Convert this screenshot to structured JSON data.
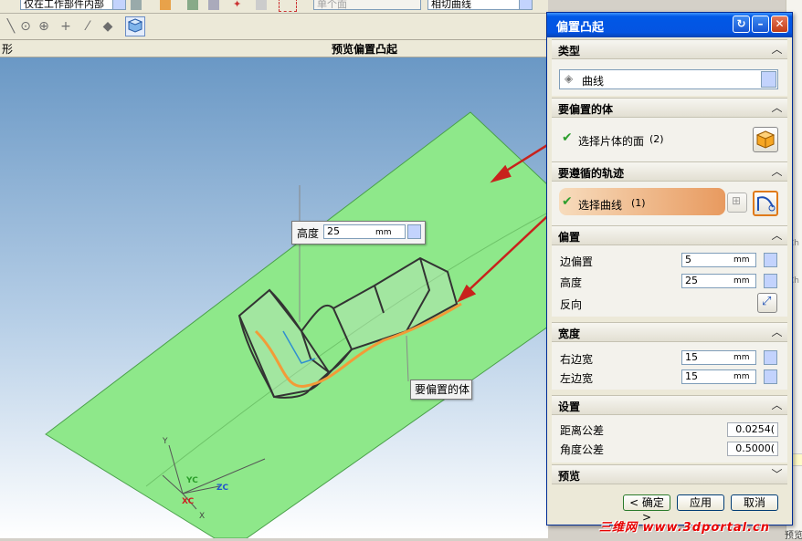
{
  "toolbar": {
    "selection_filter": "仅在工作部件内部",
    "face_rule": "单个面",
    "curve_rule": "相切曲线"
  },
  "header": {
    "left_label": "形",
    "center_label": "预览偏置凸起"
  },
  "viewport": {
    "height_callout": {
      "label": "高度",
      "value": "25",
      "unit": "mm"
    },
    "body_callout": "要偏置的体",
    "axes": {
      "y": "Y",
      "yc": "YC",
      "zc": "ZC",
      "xc": "XC",
      "x": "X"
    }
  },
  "dialog": {
    "title": "偏置凸起",
    "sections": {
      "type": {
        "title": "类型",
        "value": "曲线"
      },
      "body": {
        "title": "要偏置的体",
        "select_label": "选择片体的面",
        "select_count": "(2)"
      },
      "path": {
        "title": "要遵循的轨迹",
        "select_label": "选择曲线",
        "select_count": "(1)"
      },
      "offset": {
        "title": "偏置",
        "edge_offset": {
          "label": "边偏置",
          "value": "5",
          "unit": "mm"
        },
        "height": {
          "label": "高度",
          "value": "25",
          "unit": "mm"
        },
        "reverse": "反向"
      },
      "width": {
        "title": "宽度",
        "right": {
          "label": "右边宽",
          "value": "15",
          "unit": "mm"
        },
        "left": {
          "label": "左边宽",
          "value": "15",
          "unit": "mm"
        }
      },
      "settings": {
        "title": "设置",
        "distance_tol": {
          "label": "距离公差",
          "value": "0.0254("
        },
        "angle_tol": {
          "label": "角度公差",
          "value": "0.5000("
        }
      },
      "preview": {
        "title": "预览"
      }
    },
    "buttons": {
      "ok": "< 确定 >",
      "apply": "应用",
      "cancel": "取消"
    }
  },
  "right_strip": {
    "text1": "Ch",
    "text2": "Ch",
    "text3": "预览"
  },
  "watermark": "三维网 www.3dportal.cn",
  "colors": {
    "titlebar": "#0454e2",
    "surface": "#8ee88a",
    "selection_highlight": "#f3c89c",
    "arrow": "#c8221c",
    "path_curve": "#f29b38"
  }
}
